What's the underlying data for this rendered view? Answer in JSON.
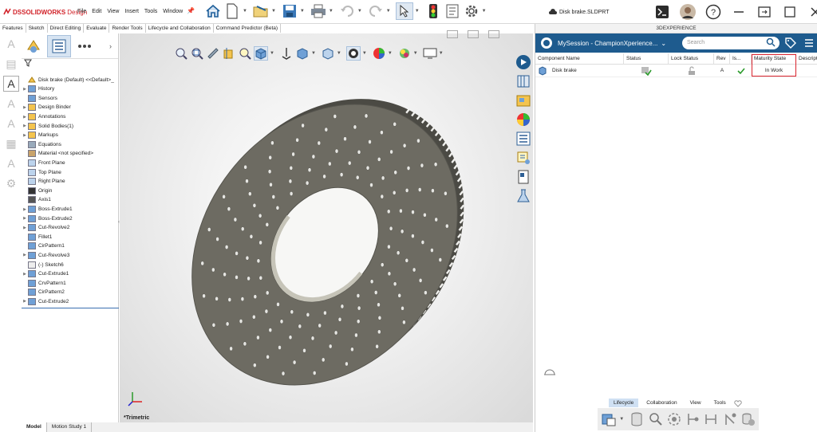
{
  "app": {
    "logo_prefix": "DS",
    "logo_name": "SOLIDWORKS",
    "logo_suffix": "Design",
    "menu": [
      "File",
      "Edit",
      "View",
      "Insert",
      "Tools",
      "Window"
    ],
    "document_title": "Disk brake.SLDPRT"
  },
  "command_tabs": [
    "Features",
    "Sketch",
    "Direct Editing",
    "Evaluate",
    "Render Tools",
    "Lifecycle and Collaboration",
    "Command Predictor (Beta)"
  ],
  "feature_tree": {
    "root": "Disk brake (Default) <<Default>_",
    "items": [
      {
        "label": "History",
        "expandable": true,
        "icon": "history-icon"
      },
      {
        "label": "Sensors",
        "expandable": false,
        "icon": "sensors-icon"
      },
      {
        "label": "Design Binder",
        "expandable": true,
        "icon": "design-binder-icon"
      },
      {
        "label": "Annotations",
        "expandable": true,
        "icon": "annotations-icon"
      },
      {
        "label": "Solid Bodies(1)",
        "expandable": true,
        "icon": "solid-bodies-icon"
      },
      {
        "label": "Markups",
        "expandable": true,
        "icon": "markups-icon"
      },
      {
        "label": "Equations",
        "expandable": false,
        "icon": "equations-icon"
      },
      {
        "label": "Material <not specified>",
        "expandable": false,
        "icon": "material-icon"
      },
      {
        "label": "Front Plane",
        "expandable": false,
        "icon": "plane-icon"
      },
      {
        "label": "Top Plane",
        "expandable": false,
        "icon": "plane-icon"
      },
      {
        "label": "Right Plane",
        "expandable": false,
        "icon": "plane-icon"
      },
      {
        "label": "Origin",
        "expandable": false,
        "icon": "origin-icon"
      },
      {
        "label": "Axis1",
        "expandable": false,
        "icon": "axis-icon"
      },
      {
        "label": "Boss-Extrude1",
        "expandable": true,
        "icon": "extrude-icon"
      },
      {
        "label": "Boss-Extrude2",
        "expandable": true,
        "icon": "extrude-icon"
      },
      {
        "label": "Cut-Revolve2",
        "expandable": true,
        "icon": "cut-revolve-icon"
      },
      {
        "label": "Fillet1",
        "expandable": false,
        "icon": "fillet-icon"
      },
      {
        "label": "CirPattern1",
        "expandable": false,
        "icon": "pattern-icon"
      },
      {
        "label": "Cut-Revolve3",
        "expandable": true,
        "icon": "cut-revolve-icon"
      },
      {
        "label": "(-) Sketch6",
        "expandable": false,
        "icon": "sketch-icon"
      },
      {
        "label": "Cut-Extrude1",
        "expandable": true,
        "icon": "cut-extrude-icon"
      },
      {
        "label": "CrvPattern1",
        "expandable": false,
        "icon": "pattern-icon"
      },
      {
        "label": "CirPattern2",
        "expandable": false,
        "icon": "pattern-icon"
      },
      {
        "label": "Cut-Extrude2",
        "expandable": true,
        "icon": "cut-extrude-icon"
      }
    ]
  },
  "viewport": {
    "view_name": "*Trimetric"
  },
  "bottom_tabs": [
    "Model",
    "Motion Study 1"
  ],
  "x3d": {
    "panel_title": "3DEXPERIENCE",
    "session": "MySession - ChampionXperience...",
    "search_placeholder": "Search",
    "columns": [
      "Component Name",
      "Status",
      "Lock Status",
      "Rev",
      "Is...",
      "Maturity State",
      "Descript"
    ],
    "row": {
      "name": "Disk brake",
      "rev": "A",
      "maturity": "In Work"
    },
    "bottom_tabs": [
      "Lifecycle",
      "Collaboration",
      "View",
      "Tools"
    ],
    "active_bottom_tab": "Lifecycle"
  },
  "colors": {
    "brand_red": "#d2232a",
    "x3d_blue": "#1e5b8e",
    "highlight_red": "#d9232d",
    "disk_gray": "#6b6a60"
  }
}
